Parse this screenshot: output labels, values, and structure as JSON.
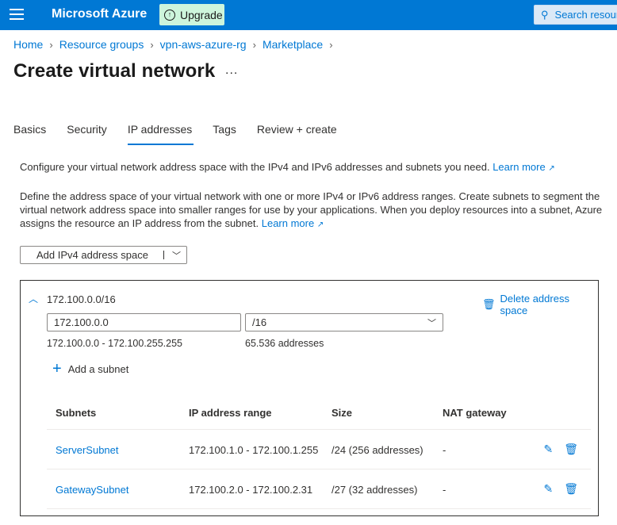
{
  "topbar": {
    "brand": "Microsoft Azure",
    "upgrade_label": "Upgrade",
    "search_placeholder": "Search resources",
    "accent": "#0078d4"
  },
  "breadcrumb": [
    "Home",
    "Resource groups",
    "vpn-aws-azure-rg",
    "Marketplace"
  ],
  "page": {
    "title": "Create virtual network",
    "more": "..."
  },
  "tabs": [
    {
      "label": "Basics",
      "active": false
    },
    {
      "label": "Security",
      "active": false
    },
    {
      "label": "IP addresses",
      "active": true
    },
    {
      "label": "Tags",
      "active": false
    },
    {
      "label": "Review + create",
      "active": false
    }
  ],
  "description": {
    "line1": "Configure your virtual network address space with the IPv4 and IPv6 addresses and subnets you need.",
    "line2": "Define the address space of your virtual network with one or more IPv4 or IPv6 address ranges. Create subnets to segment the virtual network address space into smaller ranges for use by your applications. When you deploy resources into a subnet, Azure assigns the resource an IP address from the subnet.",
    "learn_more": "Learn more"
  },
  "add_space_button": "Add IPv4 address space",
  "address_space": {
    "title": "172.100.0.0/16",
    "delete_label": "Delete address space",
    "address_value": "172.100.0.0",
    "prefix_value": "/16",
    "range": "172.100.0.0 - 172.100.255.255",
    "count": "65.536 addresses",
    "add_subnet": "Add a subnet"
  },
  "subnets": {
    "headers": [
      "Subnets",
      "IP address range",
      "Size",
      "NAT gateway"
    ],
    "rows": [
      {
        "name": "ServerSubnet",
        "range": "172.100.1.0 - 172.100.1.255",
        "size": "/24 (256 addresses)",
        "nat": "-"
      },
      {
        "name": "GatewaySubnet",
        "range": "172.100.2.0 - 172.100.2.31",
        "size": "/27 (32 addresses)",
        "nat": "-"
      }
    ]
  },
  "icons": {
    "menu": "hamburger-icon",
    "upgrade": "arrow-up-circle-icon",
    "search": "search-icon",
    "external": "external-link-icon",
    "collapse": "chevron-up-icon",
    "delete": "trash-icon",
    "add": "plus-icon",
    "edit": "pencil-icon",
    "dropdown": "chevron-down-icon"
  }
}
